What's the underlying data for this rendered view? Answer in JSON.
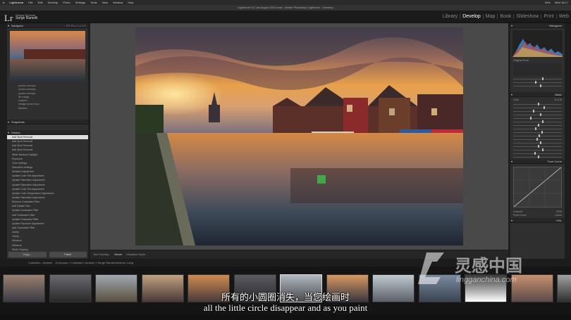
{
  "menubar": {
    "apple": "",
    "items": [
      "Lightroom",
      "File",
      "Edit",
      "Develop",
      "Photo",
      "Settings",
      "Tools",
      "View",
      "Window",
      "Help"
    ],
    "status": [
      "34%",
      "Wed 18:17"
    ]
  },
  "window_title": "Lightroom CC cat August 2015.lrcat - Adobe Photoshop Lightroom - Develop",
  "identity": {
    "logo": "Lr",
    "line1": "Serguy M photo",
    "name": "Serge Ramelli"
  },
  "modules": [
    {
      "label": "Library",
      "active": false
    },
    {
      "label": "Develop",
      "active": true
    },
    {
      "label": "Map",
      "active": false
    },
    {
      "label": "Book",
      "active": false
    },
    {
      "label": "Slideshow",
      "active": false
    },
    {
      "label": "Print",
      "active": false
    },
    {
      "label": "Web",
      "active": false
    }
  ],
  "left_panel": {
    "navigator_title": "Navigator",
    "navigator_zoom": "FIT  FILL  1:1  3:1",
    "presets": [
      "photos overlays",
      "photos overlays",
      "photos overlays",
      "lift orange",
      "sharpen",
      "vintage (local tone)",
      "Western"
    ],
    "snapshots_title": "Snapshots",
    "history_title": "History",
    "history": [
      "Add Spot Removal",
      "Add Spot Removal",
      "Add Spot Removal",
      "Add Spot Removal",
      "White Balance Daylight",
      "Exposure",
      "Tone Settings",
      "Saturation settings",
      "Defaults Adjustment",
      "Update Color Tint Adjustment",
      "Update Saturation Adjustment",
      "Update Saturation Adjustment",
      "Update Color Tint Adjustment",
      "Update Color Temperature Adjustment",
      "Update Saturation Adjustment",
      "Remove Graduated Filter",
      "Add Radial Filter",
      "Update Graduated Filter",
      "Add Graduated Filter",
      "Update Graduated Filter",
      "Update Exposure Adjustment",
      "Add Graduated Filter",
      "Clarity",
      "Clarity",
      "Vibrance",
      "Vibrance",
      "White Clipping"
    ],
    "copy_label": "Copy...",
    "paste_label": "Paste"
  },
  "toolbar": {
    "spot_overlay": "Tool Overlay :",
    "overlay_value": "Never",
    "visualize": "Visualize Spots"
  },
  "right_panel": {
    "histogram_title": "Histogram",
    "original_photo": "Original Photo",
    "basic_title": "Basic",
    "tone_curve_title": "Tone Curve",
    "channel_label": "Channel:",
    "channel_value": "RGB",
    "point_curve_label": "Point Curve:",
    "point_curve_value": "Linear",
    "hsl_title": "HSL",
    "color_tab": "Color",
    "bw_tab": "B & W"
  },
  "filmstrip": {
    "path": "Collection : Amiens",
    "count": "24 photos / 1 selected / Amiens 1 Serge Ramelli Amiens 1.dng"
  },
  "subtitles": {
    "cn": "所有的小圆圈消失，当您绘画时",
    "en": "all the little circle disappear and as you paint"
  },
  "watermark": {
    "cn": "灵感中国",
    "url": "lingganchina.com"
  },
  "colors": {
    "accent_white": "#ffffff",
    "panel_bg": "#2f2f2f",
    "center_bg": "#494949"
  }
}
